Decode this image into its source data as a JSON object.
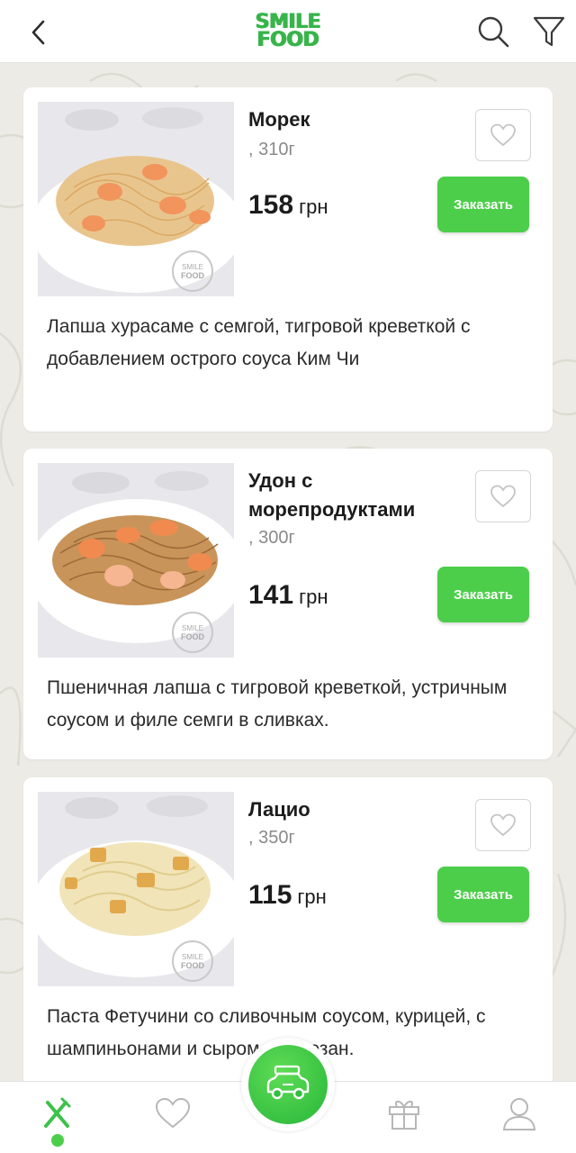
{
  "header": {
    "logo_line1": "SMILE",
    "logo_line2": "FOOD",
    "back_icon": "chevron-left-icon",
    "search_icon": "search-icon",
    "filter_icon": "filter-icon"
  },
  "colors": {
    "brand_green": "#38b44a",
    "button_green": "#4cce4a",
    "background": "#ecebe5"
  },
  "products": [
    {
      "name": "Морек",
      "weight": ", 310г",
      "price": "158",
      "currency": "грн",
      "order_label": "Заказать",
      "description": "Лапша хурасаме с семгой, тигровой креветкой с добавлением острого соуса Ким Чи",
      "watermark": "SMILE FOOD"
    },
    {
      "name": "Удон с морепродуктами",
      "weight": ", 300г",
      "price": "141",
      "currency": "грн",
      "order_label": "Заказать",
      "description": "Пшеничная лапша с тигровой креветкой, устричным соусом и филе семги в сливках.",
      "watermark": "SMILE FOOD"
    },
    {
      "name": "Лацио",
      "weight": ", 350г",
      "price": "115",
      "currency": "грн",
      "order_label": "Заказать",
      "description": "Паста Фетучини со сливочным соусом, курицей, с шампиньонами и сыром пармезан.",
      "watermark": "SMILE FOOD"
    }
  ],
  "bottom_nav": {
    "items": [
      "menu-icon",
      "heart-icon",
      "delivery-car-icon",
      "gift-icon",
      "user-icon"
    ],
    "active": "menu-icon"
  }
}
